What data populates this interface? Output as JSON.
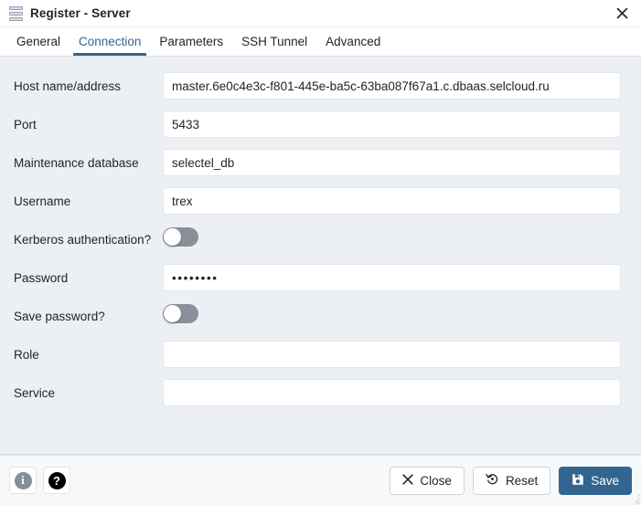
{
  "window": {
    "title": "Register - Server",
    "icon": "server-stack-icon",
    "close_icon": "close-icon"
  },
  "tabs": [
    {
      "label": "General",
      "active": false
    },
    {
      "label": "Connection",
      "active": true
    },
    {
      "label": "Parameters",
      "active": false
    },
    {
      "label": "SSH Tunnel",
      "active": false
    },
    {
      "label": "Advanced",
      "active": false
    }
  ],
  "form": {
    "fields": [
      {
        "name": "host",
        "label": "Host name/address",
        "type": "text",
        "value": "master.6e0c4e3c-f801-445e-ba5c-63ba087f67a1.c.dbaas.selcloud.ru",
        "placeholder": ""
      },
      {
        "name": "port",
        "label": "Port",
        "type": "text",
        "value": "5433",
        "placeholder": ""
      },
      {
        "name": "maintenance_database",
        "label": "Maintenance database",
        "type": "text",
        "value": "selectel_db",
        "placeholder": ""
      },
      {
        "name": "username",
        "label": "Username",
        "type": "text",
        "value": "trex",
        "placeholder": ""
      },
      {
        "name": "kerberos_authentication",
        "label": "Kerberos authentication?",
        "type": "toggle",
        "value": "off"
      },
      {
        "name": "password",
        "label": "Password",
        "type": "password",
        "value": "••••••••",
        "placeholder": ""
      },
      {
        "name": "save_password",
        "label": "Save password?",
        "type": "toggle",
        "value": "off"
      },
      {
        "name": "role",
        "label": "Role",
        "type": "text",
        "value": "",
        "placeholder": ""
      },
      {
        "name": "service",
        "label": "Service",
        "type": "text",
        "value": "",
        "placeholder": ""
      }
    ]
  },
  "footer": {
    "info_icon": "info-icon",
    "info_glyph": "i",
    "help_icon": "help-icon",
    "help_glyph": "?",
    "close_label": "Close",
    "close_icon": "close-x-icon",
    "reset_label": "Reset",
    "reset_icon": "reset-rotate-icon",
    "save_label": "Save",
    "save_icon": "save-floppy-icon"
  },
  "colors": {
    "accent": "#326690",
    "body_background": "#eceff4",
    "footer_background": "#f7f8fa",
    "toggle_off_track": "#8a9099",
    "help_icon_background": "#000000",
    "info_icon_background": "#868e96"
  }
}
